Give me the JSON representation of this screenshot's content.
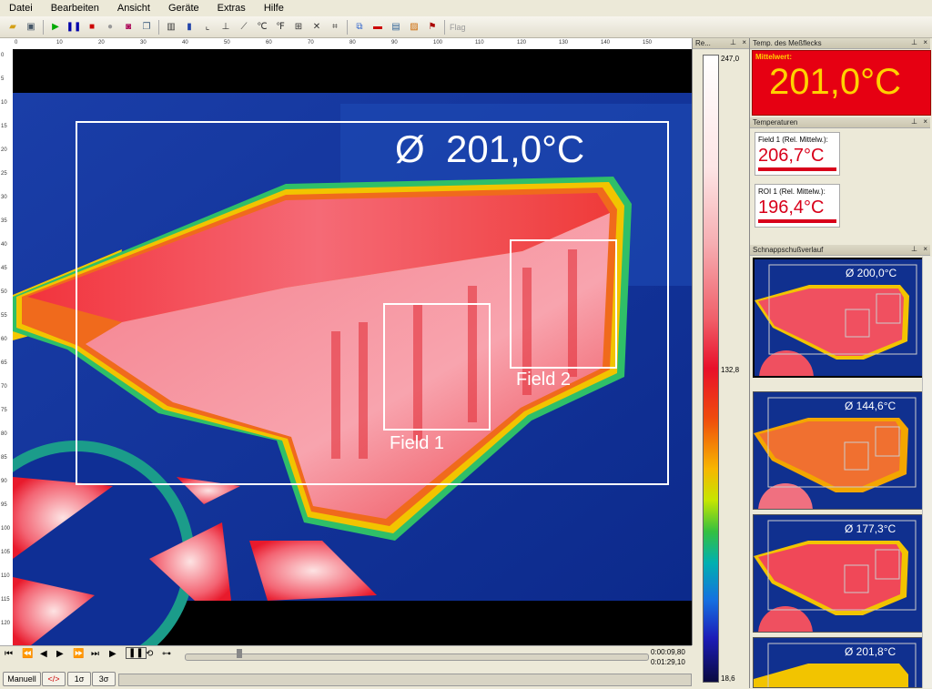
{
  "menu": [
    "Datei",
    "Bearbeiten",
    "Ansicht",
    "Geräte",
    "Extras",
    "Hilfe"
  ],
  "toolbar": {
    "icons": [
      "open-icon",
      "save-icon",
      "play-icon",
      "pause-icon",
      "stop-icon",
      "record-icon",
      "camera-icon",
      "copy-icon",
      "histogram-icon",
      "bar-chart-icon",
      "line-chart-icon",
      "profile-icon",
      "trend-icon",
      "celsius-icon",
      "temperature-icon",
      "layout-icon",
      "tools-icon",
      "grid-icon",
      "compare-icon",
      "palette-icon",
      "layers-icon"
    ],
    "flag_label": "Flag"
  },
  "ruler": {
    "top": [
      "0",
      "10",
      "20",
      "30",
      "40",
      "50",
      "60",
      "70",
      "80",
      "90",
      "100",
      "110",
      "120",
      "130",
      "140",
      "150"
    ],
    "left": [
      "0",
      "5",
      "10",
      "15",
      "20",
      "25",
      "30",
      "35",
      "40",
      "45",
      "50",
      "55",
      "60",
      "65",
      "70",
      "75",
      "80",
      "85",
      "90",
      "95",
      "100",
      "105",
      "110",
      "115",
      "120"
    ]
  },
  "image": {
    "overlay_avg": "Ø  201,0°C",
    "field1_label": "Field 1",
    "field2_label": "Field 2"
  },
  "playback": {
    "time_current": "0:00:09,80",
    "time_total": "0:01:29,10",
    "btn_manual": "Manuell",
    "btn_code": "</>",
    "btn_1s": "1σ",
    "btn_3s": "3σ"
  },
  "scale": {
    "title": "Re...",
    "max": "247,0",
    "mid": "132,8",
    "min": "18,6"
  },
  "measure_panel": {
    "title": "Temp. des Meßflecks",
    "caption": "Mittelwert:",
    "value": "201,0°C"
  },
  "temps_panel": {
    "title": "Temperaturen",
    "items": [
      {
        "label": "Field 1 (Rel. Mittelw.):",
        "value": "206,7°C"
      },
      {
        "label": "ROI 1 (Rel. Mittelw.):",
        "value": "196,4°C"
      }
    ]
  },
  "snap_panel": {
    "title": "Schnappschußverlauf",
    "items": [
      {
        "value": "Ø  200,0°C"
      },
      {
        "value": "Ø  144,6°C"
      },
      {
        "value": "Ø  177,3°C"
      },
      {
        "value": "Ø  201,8°C"
      }
    ]
  },
  "colors": {
    "alarm_red": "#e60012",
    "value_red": "#d8001a",
    "big_text_yellow": "#ffd200"
  }
}
